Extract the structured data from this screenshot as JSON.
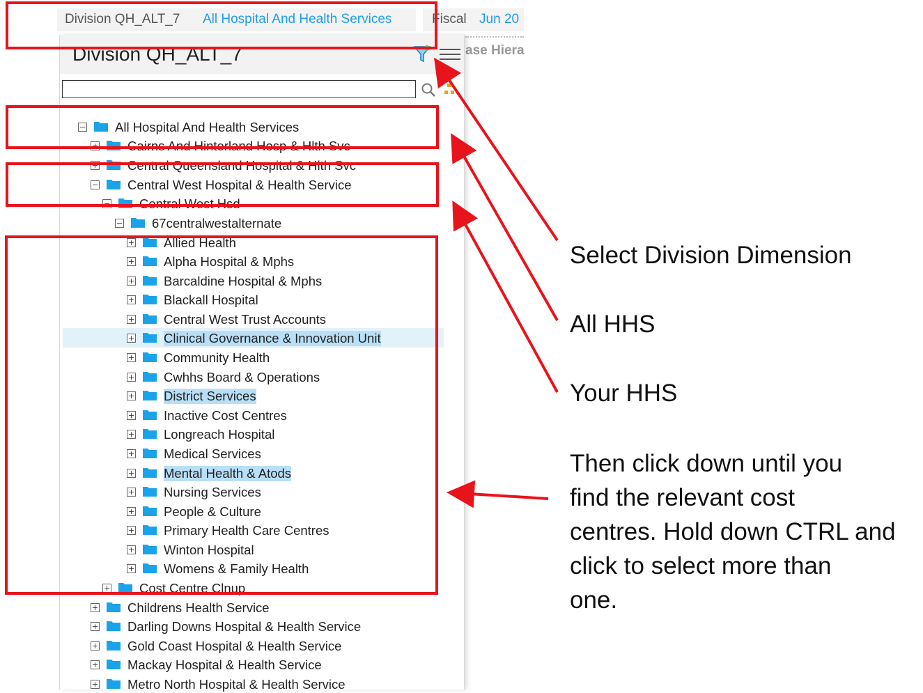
{
  "topbar": {
    "division_label": "Division QH_ALT_7",
    "division_value": "All Hospital And Health Services",
    "fiscal_label": "Fiscal",
    "fiscal_value": "Jun 20"
  },
  "panel": {
    "title": "Division QH_ALT_7",
    "side_text": "ase Hiera",
    "search_value": "",
    "icons": {
      "filter": "filter-icon",
      "menu": "menu-icon",
      "search": "search-icon",
      "tree_tool": "tree-tool-icon"
    }
  },
  "tree": [
    {
      "label": "All Hospital And Health Services",
      "toggle": "−",
      "level": 0
    },
    {
      "label": "Cairns And Hinterland Hosp & Hlth Svc",
      "toggle": "+",
      "level": 1
    },
    {
      "label": "Central Queensland Hospital & Hlth Svc",
      "toggle": "+",
      "level": 1
    },
    {
      "label": "Central West Hospital & Health Service",
      "toggle": "−",
      "level": 1
    },
    {
      "label": "Central West Hsd",
      "toggle": "−",
      "level": 2
    },
    {
      "label": "67centralwestalternate",
      "toggle": "−",
      "level": 3
    },
    {
      "label": "Allied Health",
      "toggle": "+",
      "level": 4
    },
    {
      "label": "Alpha Hospital & Mphs",
      "toggle": "+",
      "level": 4
    },
    {
      "label": "Barcaldine Hospital & Mphs",
      "toggle": "+",
      "level": 4
    },
    {
      "label": "Blackall Hospital",
      "toggle": "+",
      "level": 4
    },
    {
      "label": "Central West Trust Accounts",
      "toggle": "+",
      "level": 4
    },
    {
      "label": "Clinical Governance & Innovation Unit",
      "toggle": "+",
      "level": 4,
      "selected": true
    },
    {
      "label": "Community Health",
      "toggle": "+",
      "level": 4
    },
    {
      "label": "Cwhhs Board & Operations",
      "toggle": "+",
      "level": 4
    },
    {
      "label": "District Services",
      "toggle": "+",
      "level": 4,
      "selected": true
    },
    {
      "label": "Inactive Cost Centres",
      "toggle": "+",
      "level": 4
    },
    {
      "label": "Longreach Hospital",
      "toggle": "+",
      "level": 4
    },
    {
      "label": "Medical Services",
      "toggle": "+",
      "level": 4
    },
    {
      "label": "Mental Health & Atods",
      "toggle": "+",
      "level": 4,
      "selected": true
    },
    {
      "label": "Nursing Services",
      "toggle": "+",
      "level": 4
    },
    {
      "label": "People & Culture",
      "toggle": "+",
      "level": 4
    },
    {
      "label": "Primary Health Care Centres",
      "toggle": "+",
      "level": 4
    },
    {
      "label": "Winton Hospital",
      "toggle": "+",
      "level": 4
    },
    {
      "label": "Womens & Family Health",
      "toggle": "+",
      "level": 4
    },
    {
      "label": "Cost Centre Clnup",
      "toggle": "+",
      "level": 2
    },
    {
      "label": "Childrens Health Service",
      "toggle": "+",
      "level": 1
    },
    {
      "label": "Darling Downs Hospital & Health Service",
      "toggle": "+",
      "level": 1
    },
    {
      "label": "Gold Coast Hospital & Health Service",
      "toggle": "+",
      "level": 1
    },
    {
      "label": "Mackay Hospital & Health Service",
      "toggle": "+",
      "level": 1
    },
    {
      "label": "Metro North Hospital & Health Service",
      "toggle": "+",
      "level": 1
    }
  ],
  "annotations": {
    "select_division": "Select Division Dimension",
    "all_hhs": "All HHS",
    "your_hhs": "Your HHS",
    "instructions": [
      "Then click down until you",
      "find the relevant cost",
      "centres. Hold down CTRL and",
      "click to select more than",
      "one."
    ],
    "color": "#e8141c"
  },
  "colors": {
    "link": "#1e9de8",
    "folder": "#1aa3e8",
    "selection": "#b9dff7",
    "row_highlight": "#e3f1fb"
  }
}
